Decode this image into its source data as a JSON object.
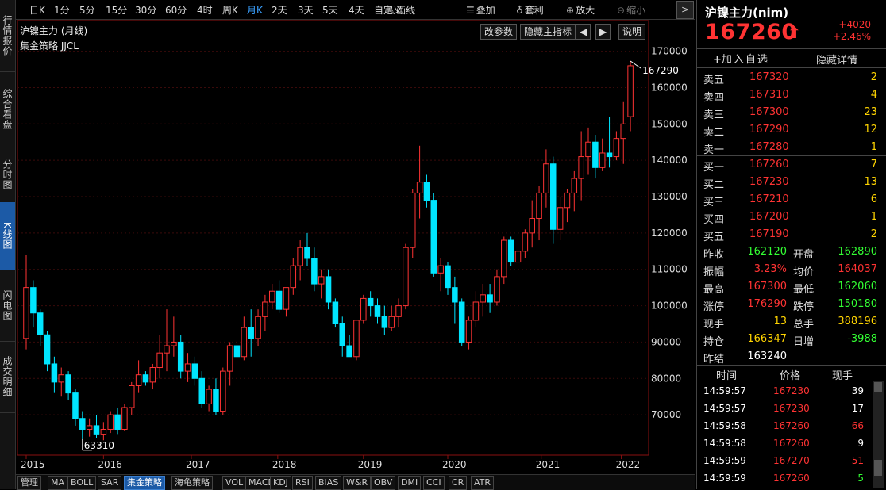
{
  "left_tabs": [
    {
      "label": "行情报价",
      "active": false
    },
    {
      "label": "综合看盘",
      "active": false
    },
    {
      "label": "分时图",
      "active": false
    },
    {
      "label": "K线图",
      "active": true
    },
    {
      "label": "闪电图",
      "active": false
    },
    {
      "label": "成交明细",
      "active": false
    }
  ],
  "toolbar": {
    "periods": [
      "日K",
      "1分",
      "5分",
      "15分",
      "30分",
      "60分",
      "4时",
      "周K",
      "月K",
      "2天",
      "3天",
      "5天",
      "4天",
      "自定义"
    ],
    "active_period": "月K",
    "draw": "画线",
    "overlay": "叠加",
    "arbitrage": "套利",
    "zoom_in": "放大",
    "zoom_out": "缩小"
  },
  "chart_header": {
    "title": "沪镍主力 (月线)",
    "strategy": "集金策略 JJCL",
    "buttons": [
      "改参数",
      "隐藏主指标",
      "◀",
      "▶",
      "说明"
    ]
  },
  "chart_data": {
    "type": "candlestick",
    "title": "沪镍主力 (月线)",
    "x_labels": [
      "2015",
      "2016",
      "2017",
      "2018",
      "2019",
      "2020",
      "2021",
      "2022"
    ],
    "y_ticks": [
      70000,
      80000,
      90000,
      100000,
      110000,
      120000,
      130000,
      140000,
      150000,
      160000,
      170000
    ],
    "ylim": [
      60000,
      171000
    ],
    "annotations": [
      {
        "text": "167290",
        "value": 167290,
        "bar_index": 86
      },
      {
        "text": "63310",
        "value": 63310,
        "bar_index": 8
      }
    ],
    "colors": {
      "up": "#ff3333",
      "down": "#00e5ff"
    },
    "candles": [
      [
        91000,
        114000,
        88000,
        105000
      ],
      [
        105000,
        107000,
        94000,
        98000
      ],
      [
        98000,
        99000,
        89000,
        92000
      ],
      [
        92000,
        93000,
        82000,
        84000
      ],
      [
        84000,
        86000,
        76000,
        79000
      ],
      [
        79000,
        83000,
        75000,
        81000
      ],
      [
        81000,
        82000,
        74000,
        76000
      ],
      [
        76000,
        77000,
        67000,
        69000
      ],
      [
        69000,
        71000,
        63310,
        66000
      ],
      [
        66000,
        69000,
        64000,
        67000
      ],
      [
        67000,
        70000,
        63500,
        64500
      ],
      [
        64500,
        68000,
        63000,
        66000
      ],
      [
        66000,
        71000,
        65000,
        70000
      ],
      [
        70000,
        72000,
        64500,
        66000
      ],
      [
        66000,
        73000,
        65500,
        72000
      ],
      [
        72000,
        79000,
        70000,
        78000
      ],
      [
        78000,
        85000,
        76000,
        81000
      ],
      [
        81000,
        82000,
        78000,
        79000
      ],
      [
        79000,
        84000,
        77000,
        83000
      ],
      [
        83000,
        92000,
        80000,
        87000
      ],
      [
        87000,
        99000,
        82000,
        89000
      ],
      [
        89000,
        97000,
        86000,
        90000
      ],
      [
        90000,
        92000,
        80000,
        82000
      ],
      [
        82000,
        87000,
        79000,
        84000
      ],
      [
        84000,
        86000,
        78000,
        80000
      ],
      [
        80000,
        82000,
        72000,
        73000
      ],
      [
        73000,
        78000,
        71000,
        77000
      ],
      [
        77000,
        80000,
        70000,
        71000
      ],
      [
        71000,
        83000,
        70000,
        82000
      ],
      [
        82000,
        90000,
        78000,
        89000
      ],
      [
        89000,
        92000,
        84000,
        86000
      ],
      [
        86000,
        97000,
        85000,
        94000
      ],
      [
        94000,
        99000,
        86000,
        91000
      ],
      [
        91000,
        99000,
        89000,
        97000
      ],
      [
        97000,
        103000,
        93000,
        101000
      ],
      [
        101000,
        106000,
        99000,
        104000
      ],
      [
        104000,
        107000,
        98000,
        99000
      ],
      [
        99000,
        105000,
        97000,
        105000
      ],
      [
        105000,
        113000,
        103000,
        111000
      ],
      [
        111000,
        118000,
        107000,
        116000
      ],
      [
        116000,
        120000,
        111000,
        113000
      ],
      [
        113000,
        116000,
        104000,
        106000
      ],
      [
        106000,
        110000,
        102000,
        108000
      ],
      [
        108000,
        110000,
        99000,
        101000
      ],
      [
        101000,
        102000,
        94000,
        95000
      ],
      [
        95000,
        97000,
        86000,
        89000
      ],
      [
        89000,
        92000,
        86000,
        86000
      ],
      [
        86000,
        92000,
        85000,
        96000
      ],
      [
        96000,
        103000,
        95000,
        102000
      ],
      [
        102000,
        104000,
        97000,
        100000
      ],
      [
        100000,
        102000,
        95000,
        97000
      ],
      [
        97000,
        100000,
        92000,
        94000
      ],
      [
        94000,
        100000,
        93000,
        97000
      ],
      [
        97000,
        102000,
        94000,
        100000
      ],
      [
        100000,
        117000,
        99000,
        116000
      ],
      [
        116000,
        132000,
        113000,
        131000
      ],
      [
        131000,
        144000,
        124000,
        134000
      ],
      [
        134000,
        136000,
        127000,
        129000
      ],
      [
        129000,
        131000,
        108000,
        109000
      ],
      [
        109000,
        113000,
        104000,
        111000
      ],
      [
        111000,
        112000,
        103000,
        105000
      ],
      [
        105000,
        108000,
        95000,
        101000
      ],
      [
        101000,
        102000,
        89000,
        90000
      ],
      [
        90000,
        97000,
        88000,
        96000
      ],
      [
        96000,
        104000,
        94000,
        101000
      ],
      [
        101000,
        106000,
        97000,
        103000
      ],
      [
        103000,
        106000,
        98000,
        101000
      ],
      [
        101000,
        110000,
        100000,
        108000
      ],
      [
        108000,
        119000,
        106000,
        118000
      ],
      [
        118000,
        119000,
        111000,
        112000
      ],
      [
        112000,
        116000,
        109000,
        115000
      ],
      [
        115000,
        121000,
        113000,
        120000
      ],
      [
        120000,
        129000,
        116000,
        124000
      ],
      [
        124000,
        133000,
        118000,
        131000
      ],
      [
        131000,
        143000,
        127000,
        139000
      ],
      [
        139000,
        141000,
        117000,
        121000
      ],
      [
        121000,
        130000,
        118000,
        127000
      ],
      [
        127000,
        132000,
        123000,
        131000
      ],
      [
        131000,
        137000,
        126000,
        135000
      ],
      [
        135000,
        148000,
        129000,
        141000
      ],
      [
        141000,
        149000,
        136000,
        145000
      ],
      [
        145000,
        147000,
        135000,
        138000
      ],
      [
        138000,
        146000,
        137000,
        142000
      ],
      [
        142000,
        152000,
        138000,
        141000
      ],
      [
        141000,
        148000,
        140000,
        146000
      ],
      [
        146000,
        156000,
        139000,
        150000
      ],
      [
        152000,
        167290,
        148000,
        166000
      ]
    ]
  },
  "bottom_tabs": [
    "管理",
    "MA",
    "BOLL",
    "SAR",
    "集金策略",
    "海龟策略",
    "VOL",
    "MACD",
    "KDJ",
    "RSI",
    "BIAS",
    "W&R",
    "OBV",
    "DMI",
    "CCI",
    "CR",
    "ATR"
  ],
  "bottom_tab_active": "集金策略",
  "panel": {
    "title": "沪镍主力(nim)",
    "price": "167260",
    "change": "+4020",
    "change_pct": "+2.46%",
    "add_watch": "加入自选",
    "hide_detail": "隐藏详情",
    "asks": [
      {
        "label": "卖五",
        "price": "167320",
        "vol": "2"
      },
      {
        "label": "卖四",
        "price": "167310",
        "vol": "4"
      },
      {
        "label": "卖三",
        "price": "167300",
        "vol": "23"
      },
      {
        "label": "卖二",
        "price": "167290",
        "vol": "12"
      },
      {
        "label": "卖一",
        "price": "167280",
        "vol": "1"
      }
    ],
    "bids": [
      {
        "label": "买一",
        "price": "167260",
        "vol": "7"
      },
      {
        "label": "买二",
        "price": "167230",
        "vol": "13"
      },
      {
        "label": "买三",
        "price": "167210",
        "vol": "6"
      },
      {
        "label": "买四",
        "price": "167200",
        "vol": "1"
      },
      {
        "label": "买五",
        "price": "167190",
        "vol": "2"
      }
    ],
    "stats": [
      {
        "l1": "昨收",
        "v1": "162120",
        "c1": "green",
        "l2": "开盘",
        "v2": "162890",
        "c2": "green"
      },
      {
        "l1": "振幅",
        "v1": "3.23%",
        "c1": "red",
        "l2": "均价",
        "v2": "164037",
        "c2": "red"
      },
      {
        "l1": "最高",
        "v1": "167300",
        "c1": "red",
        "l2": "最低",
        "v2": "162060",
        "c2": "green"
      },
      {
        "l1": "涨停",
        "v1": "176290",
        "c1": "red",
        "l2": "跌停",
        "v2": "150180",
        "c2": "green"
      },
      {
        "l1": "现手",
        "v1": "13",
        "c1": "yellow",
        "l2": "总手",
        "v2": "388196",
        "c2": "yellow"
      },
      {
        "l1": "持仓",
        "v1": "166347",
        "c1": "yellow",
        "l2": "日增",
        "v2": "-3988",
        "c2": "green"
      },
      {
        "l1": "昨结",
        "v1": "163240",
        "c1": "white",
        "l2": "",
        "v2": "",
        "c2": "white"
      }
    ],
    "tick_headers": [
      "时间",
      "价格",
      "现手"
    ],
    "ticks": [
      {
        "time": "14:59:57",
        "price": "167230",
        "vol": "39",
        "c": "white"
      },
      {
        "time": "14:59:57",
        "price": "167230",
        "vol": "17",
        "c": "white"
      },
      {
        "time": "14:59:58",
        "price": "167260",
        "vol": "66",
        "c": "red"
      },
      {
        "time": "14:59:58",
        "price": "167260",
        "vol": "9",
        "c": "white"
      },
      {
        "time": "14:59:59",
        "price": "167270",
        "vol": "51",
        "c": "red"
      },
      {
        "time": "14:59:59",
        "price": "167260",
        "vol": "5",
        "c": "green"
      }
    ]
  }
}
